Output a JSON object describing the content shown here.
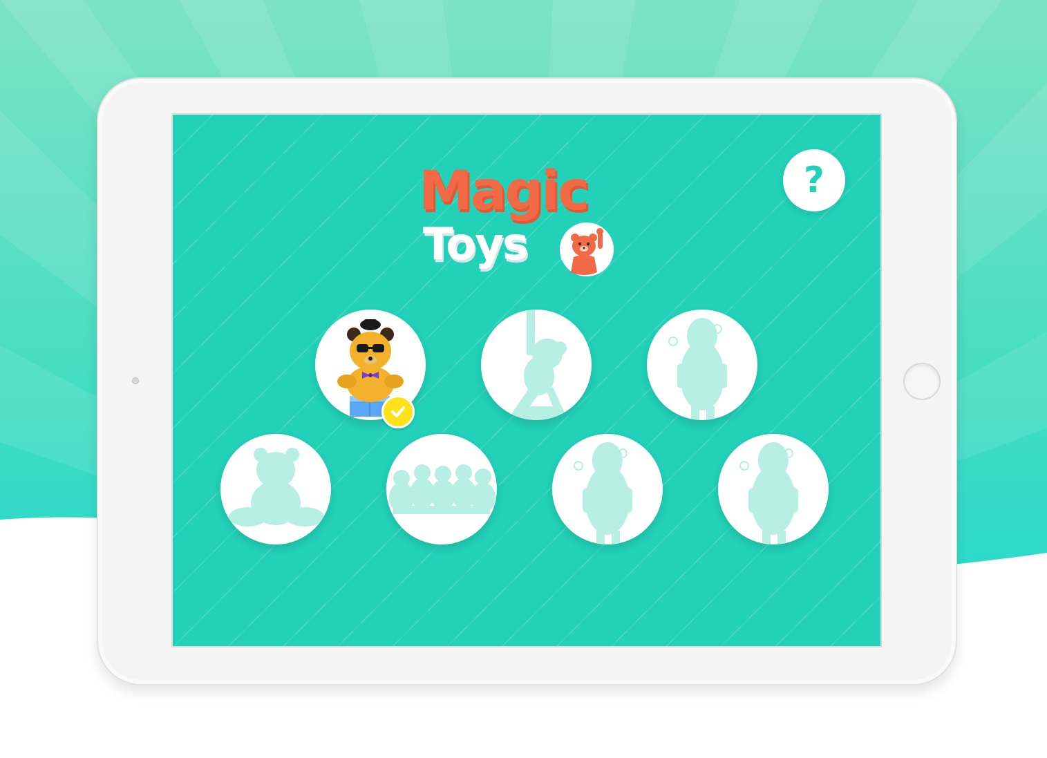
{
  "app": {
    "title_line1": "Magic",
    "title_line2": "Toys"
  },
  "help_button": {
    "label": "?",
    "icon": "question-mark-icon"
  },
  "toys": [
    {
      "id": "toy-bear",
      "unlocked": true,
      "completed": true,
      "icon": "teddy-bear-sunglasses-icon"
    },
    {
      "id": "toy-2",
      "unlocked": false,
      "completed": false,
      "icon": "locked-silhouette-icon"
    },
    {
      "id": "toy-3",
      "unlocked": false,
      "completed": false,
      "icon": "locked-silhouette-icon"
    },
    {
      "id": "toy-4",
      "unlocked": false,
      "completed": false,
      "icon": "locked-silhouette-icon"
    },
    {
      "id": "toy-5",
      "unlocked": false,
      "completed": false,
      "icon": "locked-silhouette-icon"
    },
    {
      "id": "toy-6",
      "unlocked": false,
      "completed": false,
      "icon": "locked-silhouette-icon"
    },
    {
      "id": "toy-7",
      "unlocked": false,
      "completed": false,
      "icon": "locked-silhouette-icon"
    }
  ],
  "colors": {
    "screen_bg": "#22d1b8",
    "title_accent": "#f26a45",
    "silhouette": "#b7efe5",
    "check_badge": "#ffe21a"
  }
}
